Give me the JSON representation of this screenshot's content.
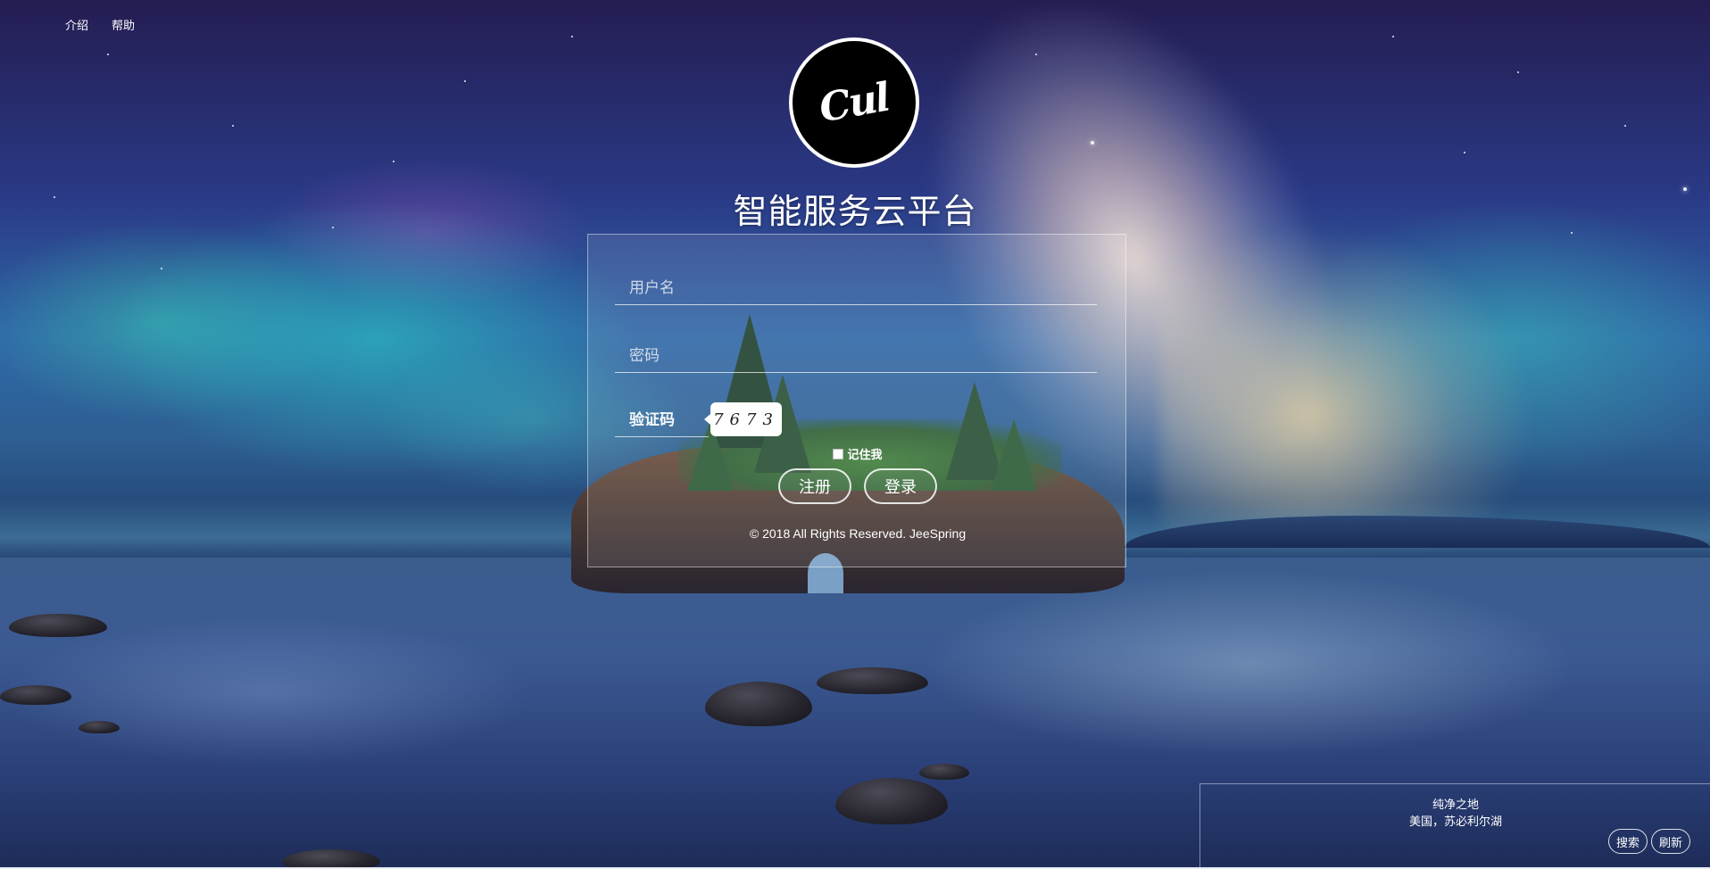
{
  "nav": {
    "items": [
      {
        "label": "介绍"
      },
      {
        "label": "帮助"
      }
    ]
  },
  "logo": {
    "text": "Cul"
  },
  "title": "智能服务云平台",
  "login": {
    "username_placeholder": "用户名",
    "password_placeholder": "密码",
    "captcha_placeholder": "验证码",
    "captcha_code": "7673",
    "remember_label": "记住我",
    "register_label": "注册",
    "login_label": "登录",
    "copyright": "© 2018 All Rights Reserved. JeeSpring"
  },
  "background_info": {
    "title": "纯净之地",
    "location": "美国，苏必利尔湖",
    "search_label": "搜索",
    "refresh_label": "刷新"
  }
}
